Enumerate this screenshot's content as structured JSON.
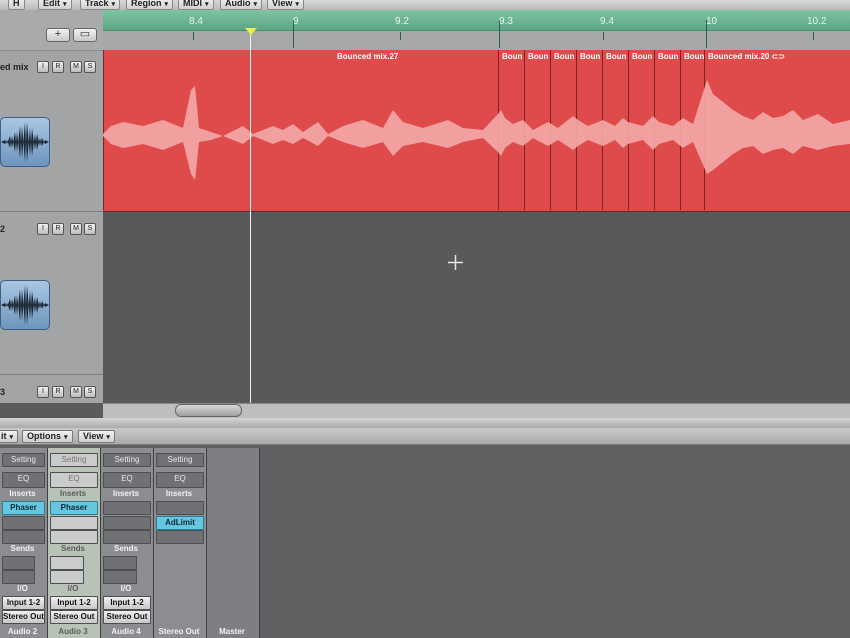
{
  "menubar": {
    "items": [
      {
        "label": "H"
      },
      {
        "label": "Edit"
      },
      {
        "label": "Track"
      },
      {
        "label": "Region"
      },
      {
        "label": "MIDI"
      },
      {
        "label": "Audio"
      },
      {
        "label": "View"
      }
    ]
  },
  "header_buttons": {
    "add": "+",
    "folder": "▭"
  },
  "tracks": [
    {
      "name": "ed mix",
      "buttons": [
        "I",
        "R",
        "M",
        "S"
      ]
    },
    {
      "name": "2",
      "buttons": [
        "I",
        "R",
        "M",
        "S"
      ]
    },
    {
      "name": "3",
      "buttons": [
        "I",
        "R",
        "M",
        "S"
      ]
    }
  ],
  "ruler": {
    "labels": [
      "8.4",
      "9",
      "9.2",
      "9.3",
      "9.4",
      "10",
      "10.2"
    ]
  },
  "regions": [
    {
      "name": "Bounced mix.27"
    },
    {
      "name": "Boun"
    },
    {
      "name": "Boun"
    },
    {
      "name": "Boun"
    },
    {
      "name": "Boun"
    },
    {
      "name": "Boun"
    },
    {
      "name": "Boun"
    },
    {
      "name": "Boun"
    },
    {
      "name": "Boun"
    },
    {
      "name": "Bounced mix.20 ⊂⊃"
    }
  ],
  "mixer_toolbar": {
    "items": [
      {
        "label": "it"
      },
      {
        "label": "Options"
      },
      {
        "label": "View"
      }
    ]
  },
  "strips": [
    {
      "setting": "Setting",
      "eq": "EQ",
      "inserts": "Inserts",
      "insert1": "Phaser",
      "sends": "Sends",
      "io": "I/O",
      "input": "Input 1-2",
      "output": "Stereo Out",
      "name": "Audio 2"
    },
    {
      "setting": "Setting",
      "eq": "EQ",
      "inserts": "Inserts",
      "insert1": "Phaser",
      "sends": "Sends",
      "io": "I/O",
      "input": "Input 1-2",
      "output": "Stereo Out",
      "name": "Audio 3"
    },
    {
      "setting": "Setting",
      "eq": "EQ",
      "inserts": "Inserts",
      "insert1": "",
      "sends": "Sends",
      "io": "I/O",
      "input": "Input 1-2",
      "output": "Stereo Out",
      "name": "Audio 4"
    },
    {
      "setting": "Setting",
      "eq": "EQ",
      "inserts": "Inserts",
      "insert1": "AdLimit",
      "name": "Stereo Out"
    },
    {
      "name": "Master"
    }
  ],
  "colors": {
    "region": "#df4a4a",
    "waveform": "#f3a9a9",
    "ruler_cycle": "#6cb694",
    "plugin_slot": "#66c6dd"
  }
}
